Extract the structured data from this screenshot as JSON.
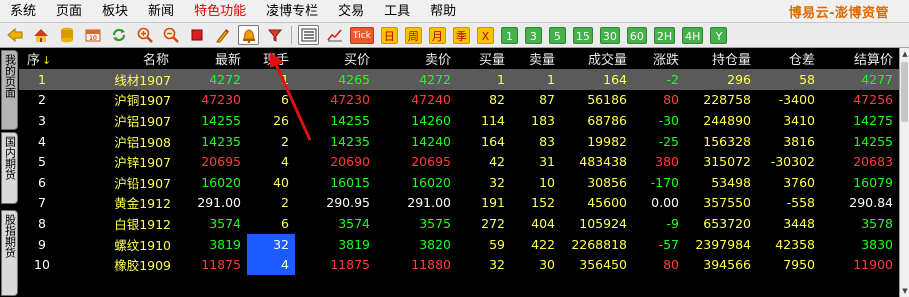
{
  "menu": {
    "items": [
      "系统",
      "页面",
      "板块",
      "新闻",
      "特色功能",
      "凌博专栏",
      "交易",
      "工具",
      "帮助"
    ],
    "brand": "博易云-澎博资管"
  },
  "toolbar": {
    "chips": [
      "Tick",
      "日",
      "周",
      "月",
      "季",
      "X",
      "1",
      "3",
      "5",
      "15",
      "30",
      "60",
      "2H",
      "4H",
      "Y"
    ]
  },
  "sidetabs": {
    "tab1": "我的页面",
    "tab2": "国内期货",
    "tab3": "股指期货"
  },
  "table": {
    "headers": [
      "序",
      "名称",
      "最新",
      "现手",
      "买价",
      "卖价",
      "买量",
      "卖量",
      "成交量",
      "涨跌",
      "持仓量",
      "仓差",
      "结算价"
    ],
    "sort_marker": "↓",
    "rows": [
      [
        "1",
        "线材1907",
        "4272",
        "1",
        "4265",
        "4272",
        "1",
        "1",
        "164",
        "-2",
        "296",
        "58",
        "4277"
      ],
      [
        "2",
        "沪铜1907",
        "47230",
        "6",
        "47230",
        "47240",
        "82",
        "87",
        "56186",
        "80",
        "228758",
        "-3400",
        "47256"
      ],
      [
        "3",
        "沪铝1907",
        "14255",
        "26",
        "14255",
        "14260",
        "114",
        "183",
        "68786",
        "-30",
        "244890",
        "3410",
        "14275"
      ],
      [
        "4",
        "沪铝1908",
        "14235",
        "2",
        "14235",
        "14240",
        "164",
        "83",
        "19982",
        "-25",
        "156328",
        "3816",
        "14255"
      ],
      [
        "5",
        "沪锌1907",
        "20695",
        "4",
        "20690",
        "20695",
        "42",
        "31",
        "483438",
        "380",
        "315072",
        "-30302",
        "20683"
      ],
      [
        "6",
        "沪铅1907",
        "16020",
        "40",
        "16015",
        "16020",
        "32",
        "10",
        "30856",
        "-170",
        "53498",
        "3760",
        "16079"
      ],
      [
        "7",
        "黄金1912",
        "291.00",
        "2",
        "290.95",
        "291.00",
        "191",
        "152",
        "45600",
        "0.00",
        "357550",
        "-558",
        "290.84"
      ],
      [
        "8",
        "白银1912",
        "3574",
        "6",
        "3574",
        "3575",
        "272",
        "404",
        "105924",
        "-9",
        "653720",
        "3448",
        "3578"
      ],
      [
        "9",
        "螺纹1910",
        "3819",
        "32",
        "3819",
        "3820",
        "59",
        "422",
        "2268818",
        "-57",
        "2397984",
        "42358",
        "3830"
      ],
      [
        "10",
        "橡胶1909",
        "11875",
        "4",
        "11875",
        "11880",
        "32",
        "30",
        "356450",
        "80",
        "394566",
        "7950",
        "11900"
      ]
    ]
  },
  "colors": {
    "up": "#ff3c3c",
    "down": "#1aff1a",
    "name": "#ffff54",
    "selected_row_bg": "#5a5a5a",
    "highlight_cell_bg": "#1a5cff",
    "annotation_arrow": "#e01010"
  },
  "icons": [
    "back-arrow-icon",
    "home-icon",
    "database-icon",
    "calendar-icon",
    "refresh-icon",
    "zoom-in-icon",
    "zoom-out-icon",
    "stop-icon",
    "pencil-icon",
    "alarm-bell-icon",
    "filter-icon",
    "quote-list-icon",
    "kline-icon"
  ]
}
